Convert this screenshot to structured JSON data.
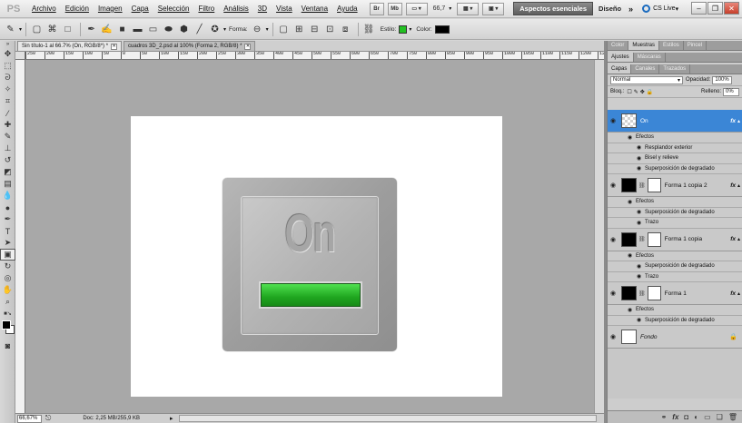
{
  "app": {
    "logo": "PS"
  },
  "menu": [
    "Archivo",
    "Edición",
    "Imagen",
    "Capa",
    "Selección",
    "Filtro",
    "Análisis",
    "3D",
    "Vista",
    "Ventana",
    "Ayuda"
  ],
  "menubar": {
    "br_label": "Br",
    "mb_label": "Mb",
    "zoom": "66,7",
    "workspace": "Aspectos esenciales",
    "diseno": "Diseño",
    "more": "»",
    "cslive": "CS Live"
  },
  "options": {
    "forma_label": "Forma:",
    "estilo_label": "Estilo:",
    "color_label": "Color:",
    "color_value": "#000000"
  },
  "tabs": [
    {
      "label": "Sin título-1 al 66.7% (On, RGB/8*) *",
      "active": true
    },
    {
      "label": "cuadros 3D_2.psd al 100% (Forma 2, RGB/8) *",
      "active": false
    }
  ],
  "ruler": [
    "250",
    "200",
    "150",
    "100",
    "50",
    "0",
    "50",
    "100",
    "150",
    "200",
    "250",
    "300",
    "350",
    "400",
    "450",
    "500",
    "550",
    "600",
    "650",
    "700",
    "750",
    "800",
    "850",
    "900",
    "950",
    "1000",
    "1050",
    "1100",
    "1150",
    "1200",
    "125"
  ],
  "canvas": {
    "on_text": "On",
    "progress": 1.0,
    "bar_color": "#22b522"
  },
  "status": {
    "zoom": "66,67%",
    "doc": "Doc: 2,25 MB/255,9 KB"
  },
  "panels": {
    "top_tabs": [
      "Color",
      "Muestras",
      "Estilos",
      "Pincel"
    ],
    "mid_tabs": [
      "Ajustes",
      "Máscaras"
    ],
    "layer_tabs": [
      "Capas",
      "Canales",
      "Trazados"
    ],
    "blend_mode": "Normal",
    "opacity_label": "Opacidad:",
    "opacity": "100%",
    "lock_label": "Bloq.:",
    "fill_label": "Relleno:",
    "fill": "0%"
  },
  "layers": [
    {
      "name": "On",
      "thumb": "check",
      "selected": true,
      "fx": true,
      "effects": [
        "Resplandor exterior",
        "Bisel y relieve",
        "Superposición de degradado"
      ]
    },
    {
      "name": "Forma 1 copia 2",
      "thumb": "black",
      "selected": false,
      "fx": true,
      "effects": [
        "Superposición de degradado",
        "Trazo"
      ]
    },
    {
      "name": "Forma 1 copia",
      "thumb": "black",
      "selected": false,
      "fx": true,
      "effects": [
        "Superposición de degradado",
        "Trazo"
      ]
    },
    {
      "name": "Forma 1",
      "thumb": "black",
      "selected": false,
      "fx": true,
      "effects": [
        "Superposición de degradado"
      ]
    },
    {
      "name": "Fondo",
      "thumb": "white",
      "selected": false,
      "fx": false,
      "effects": []
    }
  ],
  "effects_label": "Efectos",
  "bottom_icons": [
    "link-icon",
    "fx-icon",
    "mask-icon",
    "adjustment-icon",
    "folder-icon",
    "new-layer-icon",
    "trash-icon"
  ]
}
